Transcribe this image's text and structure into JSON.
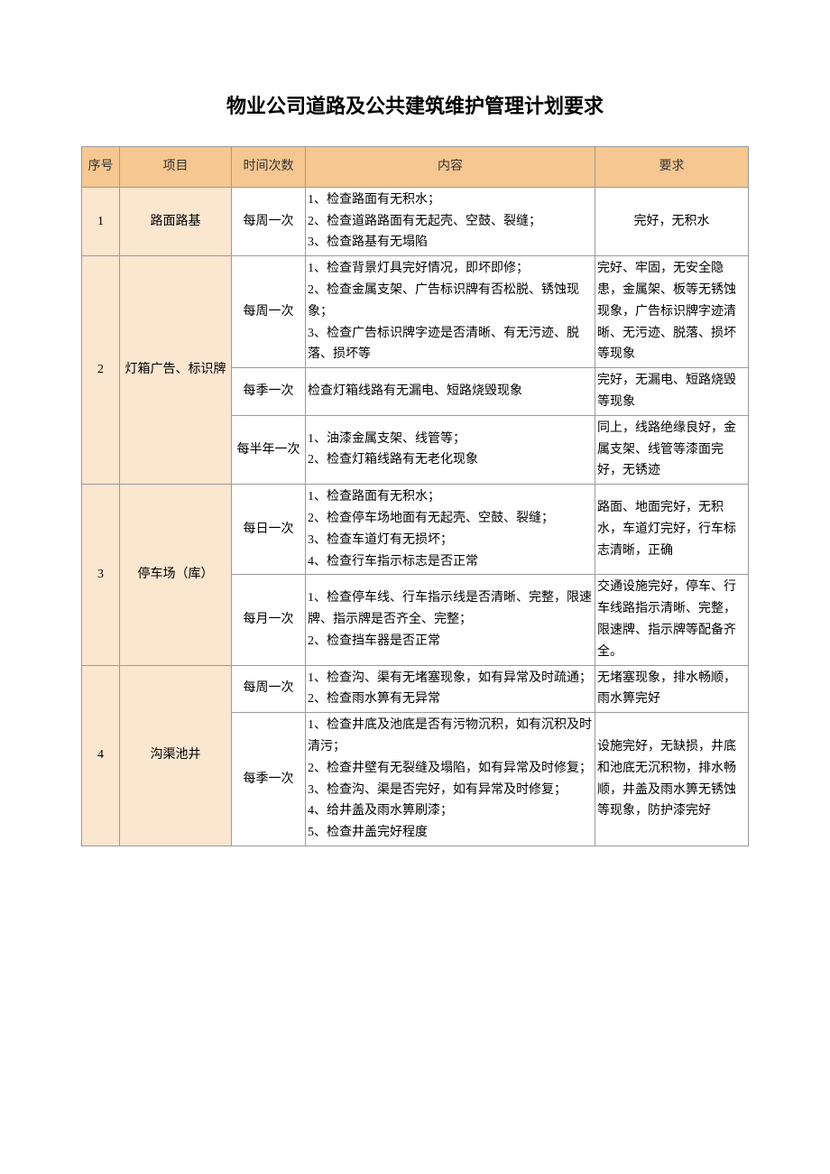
{
  "title": "物业公司道路及公共建筑维护管理计划要求",
  "headers": {
    "seq": "序号",
    "item": "项目",
    "freq": "时间次数",
    "content": "内容",
    "req": "要求"
  },
  "rows": [
    {
      "seq": "1",
      "item": "路面路基",
      "sub": [
        {
          "freq": "每周一次",
          "content": "1、检查路面有无积水；\n2、检查道路路面有无起壳、空鼓、裂缝；\n3、检查路基有无塌陷",
          "req": "完好，无积水"
        }
      ]
    },
    {
      "seq": "2",
      "item": "灯箱广告、标识牌",
      "sub": [
        {
          "freq": "每周一次",
          "content": "1、检查背景灯具完好情况，即坏即修；\n2、检查金属支架、广告标识牌有否松脱、锈蚀现象；\n3、检查广告标识牌字迹是否清晰、有无污迹、脱落、损坏等",
          "req": "完好、牢固，无安全隐患，金属架、板等无锈蚀现象，广告标识牌字迹清晰、无污迹、脱落、损坏等现象"
        },
        {
          "freq": "每季一次",
          "content": "检查灯箱线路有无漏电、短路烧毁现象",
          "req": "完好，无漏电、短路烧毁等现象"
        },
        {
          "freq": "每半年一次",
          "content": "1、油漆金属支架、线管等；\n2、检查灯箱线路有无老化现象",
          "req": "同上，线路绝缘良好，金属支架、线管等漆面完好，无锈迹"
        }
      ]
    },
    {
      "seq": "3",
      "item": "停车场（库）",
      "sub": [
        {
          "freq": "每日一次",
          "content": "1、检查路面有无积水；\n2、检查停车场地面有无起壳、空鼓、裂缝；\n3、检查车道灯有无损坏；\n4、检查行车指示标志是否正常",
          "req": "路面、地面完好，无积水，车道灯完好，行车标志清晰，正确"
        },
        {
          "freq": "每月一次",
          "content": "1、检查停车线、行车指示线是否清晰、完整，限速牌、指示牌是否齐全、完整；\n2、检查挡车器是否正常",
          "req": "交通设施完好，停车、行车线路指示清晰、完整，限速牌、指示牌等配备齐全。"
        }
      ]
    },
    {
      "seq": "4",
      "item": "沟渠池井",
      "sub": [
        {
          "freq": "每周一次",
          "content": "1、检查沟、渠有无堵塞现象，如有异常及时疏通；\n2、检查雨水箅有无异常",
          "req": "无堵塞现象，排水畅顺，雨水箅完好"
        },
        {
          "freq": "每季一次",
          "content": "1、检查井底及池底是否有污物沉积，如有沉积及时清污；\n2、检查井壁有无裂缝及塌陷，如有异常及时修复；\n3、检查沟、渠是否完好，如有异常及时修复；\n4、给井盖及雨水箅刷漆；\n5、检查井盖完好程度",
          "req": "设施完好，无缺损，井底和池底无沉积物，排水畅顺，井盖及雨水箅无锈蚀等现象，防护漆完好"
        }
      ]
    }
  ]
}
